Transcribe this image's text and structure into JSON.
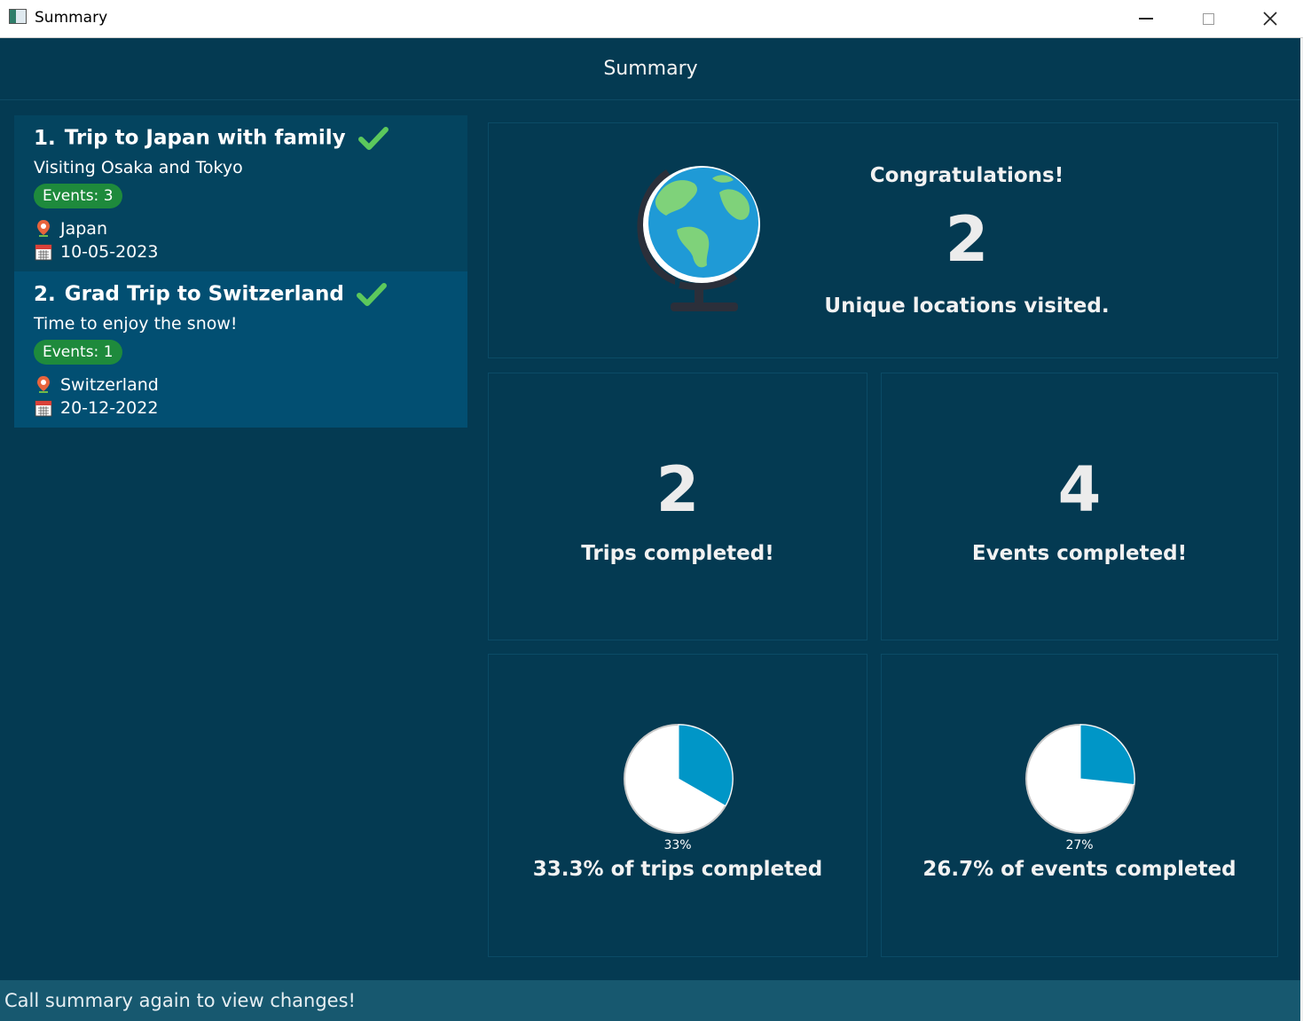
{
  "window": {
    "title": "Summary"
  },
  "header": {
    "title": "Summary"
  },
  "trips": [
    {
      "num": "1.",
      "title": "Trip to Japan with family",
      "description": "Visiting Osaka and Tokyo",
      "events": "Events: 3",
      "location": "Japan",
      "date": "10-05-2023"
    },
    {
      "num": "2.",
      "title": "Grad Trip to Switzerland",
      "description": "Time to enjoy the snow!",
      "events": "Events: 1",
      "location": "Switzerland",
      "date": "20-12-2022"
    }
  ],
  "summary": {
    "congrats": "Congratulations!",
    "unique_locations": "2",
    "unique_locations_label": "Unique locations visited.",
    "trips_completed": "2",
    "trips_completed_label": "Trips completed!",
    "events_completed": "4",
    "events_completed_label": "Events completed!"
  },
  "chart_data": [
    {
      "type": "pie",
      "slices": [
        {
          "label": "33%",
          "value": 33.3
        }
      ],
      "completed_fraction": 0.333,
      "data_label": "33%",
      "caption": "33.3% of trips completed"
    },
    {
      "type": "pie",
      "slices": [
        {
          "label": "27%",
          "value": 26.7
        }
      ],
      "completed_fraction": 0.267,
      "data_label": "27%",
      "caption": "26.7% of events completed"
    }
  ],
  "status": {
    "text": "Call summary again to view changes!"
  },
  "colors": {
    "background": "#043a52",
    "pie_fill": "#0096c7",
    "badge": "#1e8a3c",
    "check": "#5cc85c"
  }
}
